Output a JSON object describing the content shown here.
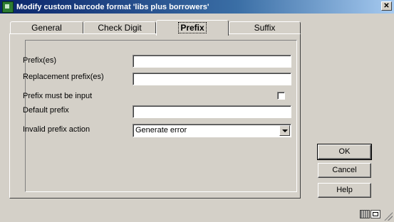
{
  "window": {
    "title": "Modify custom barcode format 'libs plus borrowers'",
    "close_label": "✕"
  },
  "tabs": [
    {
      "label": "General",
      "active": false
    },
    {
      "label": "Check Digit",
      "active": false
    },
    {
      "label": "Prefix",
      "active": true
    },
    {
      "label": "Suffix",
      "active": false
    }
  ],
  "form": {
    "prefixes": {
      "label": "Prefix(es)",
      "value": ""
    },
    "replacement_prefixes": {
      "label": "Replacement prefix(es)",
      "value": ""
    },
    "prefix_must_be_input": {
      "label": "Prefix must be input",
      "checked": false
    },
    "default_prefix": {
      "label": "Default prefix",
      "value": ""
    },
    "invalid_prefix_action": {
      "label": "Invalid prefix action",
      "selected": "Generate error"
    }
  },
  "buttons": {
    "ok": "OK",
    "cancel": "Cancel",
    "help": "Help"
  }
}
